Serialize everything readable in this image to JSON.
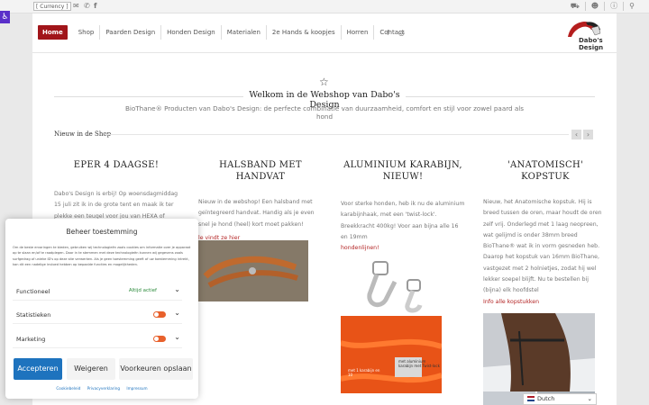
{
  "topbar": {
    "currency": "[ Currency ]",
    "icons": [
      "email-icon",
      "whatsapp-icon",
      "facebook-icon"
    ],
    "right_icons": [
      "cart-icon",
      "user-icon",
      "info-icon",
      "translate-icon"
    ]
  },
  "nav": {
    "items": [
      "Home",
      "Shop",
      "Paarden Design",
      "Honden Design",
      "Materialen",
      "2e Hands & koopjes",
      "Horren",
      "Contact"
    ],
    "social": [
      "facebook-icon",
      "instagram-icon"
    ],
    "logo_text": "Dabo's Design"
  },
  "welcome": {
    "title": "Welkom in de Webshop van Dabo's Design",
    "subtitle": "BioThane® Producten van Dabo's Design: de perfecte combinatie van duurzaamheid, comfort en stijl voor zowel paard als hond"
  },
  "shop": {
    "heading": "Nieuw in de Shop",
    "columns": [
      {
        "title": "EPER 4 DAAGSE!",
        "text": "Dabo's Design is erbij! Op woensdagmiddag 15 juli zit ik in de grote tent en maak ik ter plekke een teugel voor jou van HEXA of BioThane® voor een",
        "link": ""
      },
      {
        "title": "HALSBAND MET HANDVAT",
        "text": "Nieuw in de webshop! Een halsband met geïntegreerd handvat. Handig als je even snel je hond (heel) kort moet pakken!",
        "link": "le vindt ze hier"
      },
      {
        "title": "ALUMINIUM KARABIJN, NIEUW!",
        "text": "Voor sterke honden, heb ik nu de aluminium karabijnhaak, met een 'twist-lock'. Breekkracht 400kg! Voor aan bijna alle 16 en 19mm",
        "link": "hondenlijnen!"
      },
      {
        "title": "'ANATOMISCH' KOPSTUK",
        "text": "Nieuw, het Anatomische kopstuk. Hij is breed tussen de oren, maar houdt de oren zelf vrij. Onderlegd met 1 laag neopreen, wat gelijmd is onder 38mm breed BioThane® wat ik in vorm gesneden heb. Daarop het kopstuk van 16mm BioThane, vastgezet met 2 holnietjes, zodat hij wel lekker soepel blijft. Nu te bestellen bij (bijna) elk hoofdstel",
        "link": "Info alle kopstukken"
      }
    ],
    "image_caption_1": "met aluminium karabijn met Twist-lock",
    "image_caption_2": "met 1 karabijn en 10"
  },
  "cookie": {
    "title": "Beheer toestemming",
    "text": "Om de beste ervaringen te bieden, gebruiken wij technologieën zoals cookies om informatie over je apparaat op te slaan en/of te raadplegen. Door in te stemmen met deze technologieën kunnen wij gegevens zoals surfgedrag of unieke ID's op deze site verwerken. Als je geen toestemming geeft of uw toestemming intrekt, kan dit een nadelige invloed hebben op bepaalde functies en mogelijkheden.",
    "prefs": [
      {
        "label": "Functioneel",
        "status": "Altijd actief"
      },
      {
        "label": "Statistieken",
        "status": ""
      },
      {
        "label": "Marketing",
        "status": ""
      }
    ],
    "accept": "Accepteren",
    "deny": "Weigeren",
    "save": "Voorkeuren opslaan",
    "links": [
      "Cookiebeleid",
      "Privacyverklaring",
      "Impressum"
    ]
  },
  "language": "Dutch"
}
